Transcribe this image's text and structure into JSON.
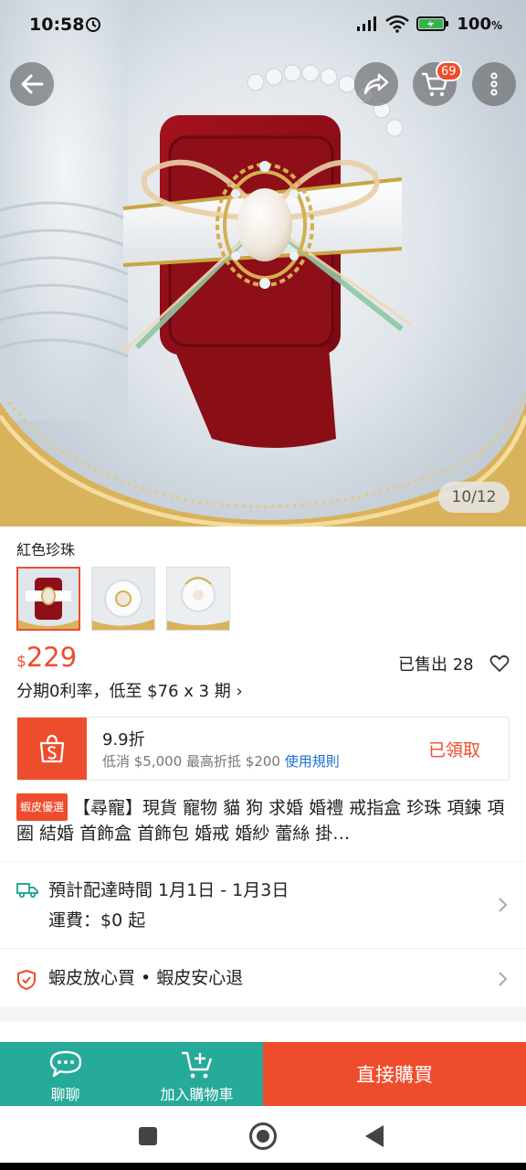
{
  "status_bar": {
    "time": "10:58",
    "battery_pct": "100"
  },
  "top_nav": {
    "cart_count": "69",
    "image_counter": "10/12"
  },
  "product": {
    "variant_label": "紅色珍珠",
    "price_currency": "$",
    "price_value": "229",
    "sold_text": "已售出 28",
    "installment_text": "分期0利率，低至 $76 x 3 期 ›",
    "voucher": {
      "title": "9.9折",
      "desc": "低消 $5,000 最高折抵 $200",
      "rule_link": "使用規則",
      "claimed": "已領取"
    },
    "tag": "蝦皮優選",
    "title": "【尋寵】現貨 寵物 貓 狗 求婚 婚禮 戒指盒 珍珠 項鍊 項圈 結婚 首飾盒 首飾包 婚戒 婚紗 蕾絲 掛…"
  },
  "delivery": {
    "time_text": "預計配達時間 1月1日 - 1月3日",
    "shipping_text": "運費：$0 起"
  },
  "guarantee": {
    "text": "蝦皮放心買 • 蝦皮安心退"
  },
  "bottom_bar": {
    "chat_label": "聊聊",
    "add_cart_label": "加入購物車",
    "buy_label": "直接購買"
  },
  "colors": {
    "brand": "#ee4d2d",
    "teal": "#26aa99",
    "link": "#1b6fd1"
  },
  "icons": [
    "alarm-icon",
    "wifi-icon",
    "signal-icon",
    "battery-icon",
    "back-arrow-icon",
    "share-icon",
    "cart-icon",
    "more-icon",
    "heart-icon",
    "shopee-bag-icon",
    "truck-icon",
    "shield-icon",
    "chevron-right-icon",
    "chat-icon",
    "add-cart-icon"
  ]
}
